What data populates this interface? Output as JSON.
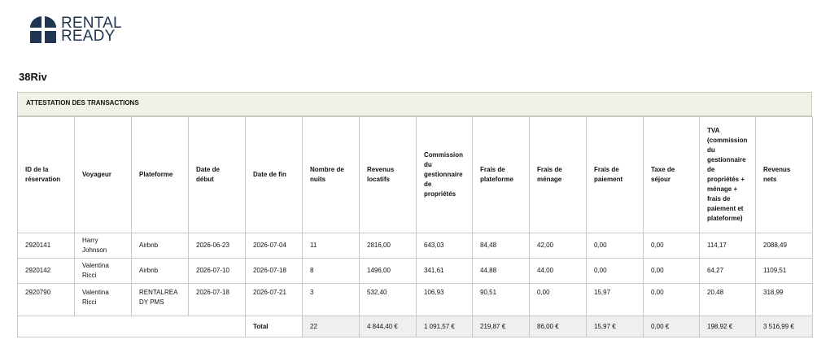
{
  "brand": {
    "logo_line1": "RENTAL",
    "logo_line2": "READY",
    "color": "#1f3550"
  },
  "property_name": "38Riv",
  "section_title": "ATTESTATION DES TRANSACTIONS",
  "table": {
    "headers": [
      "ID de la réservation",
      "Voyageur",
      "Plateforme",
      "Date de début",
      "Date de fin",
      "Nombre de nuits",
      "Revenus locatifs",
      "Commission du gestionnaire de propriétés",
      "Frais de plateforme",
      "Frais de ménage",
      "Frais de paiement",
      "Taxe de séjour",
      "TVA (commission du gestionnaire de propriétés + ménage + frais de paiement et plateforme)",
      "Revenus nets"
    ],
    "rows": [
      [
        "2920141",
        "Harry Johnson",
        "Airbnb",
        "2026-06-23",
        "2026-07-04",
        "11",
        "2816,00",
        "643,03",
        "84,48",
        "42,00",
        "0,00",
        "0,00",
        "114,17",
        "2088,49"
      ],
      [
        "2920142",
        "Valentina Ricci",
        "Airbnb",
        "2026-07-10",
        "2026-07-18",
        "8",
        "1496,00",
        "341,61",
        "44,88",
        "44,00",
        "0,00",
        "0,00",
        "64,27",
        "1109,51"
      ],
      [
        "2920790",
        "Valentina Ricci",
        "RENTALREADY PMS",
        "2026-07-18",
        "2026-07-21",
        "3",
        "532,40",
        "106,93",
        "90,51",
        "0,00",
        "15,97",
        "0,00",
        "20,48",
        "318,99"
      ]
    ],
    "totals": {
      "label": "Total",
      "values": [
        "22",
        "4 844,40 €",
        "1 091,57 €",
        "219,87 €",
        "86,00 €",
        "15,97 €",
        "0,00 €",
        "198,92 €",
        "3 516,99 €"
      ]
    }
  }
}
